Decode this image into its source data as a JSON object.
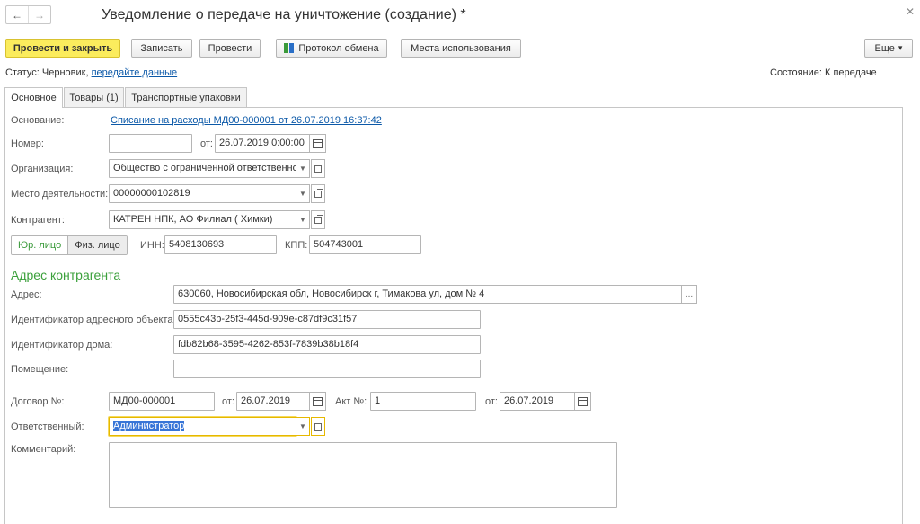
{
  "header": {
    "title": "Уведомление о передаче на уничтожение (создание) *",
    "back_icon": "arrow-left-icon",
    "forward_icon": "arrow-right-icon",
    "close_icon": "close-icon"
  },
  "toolbar": {
    "post_close": "Провести и закрыть",
    "save": "Записать",
    "post": "Провести",
    "exchange_protocol": "Протокол обмена",
    "usage_places": "Места использования",
    "more": "Еще",
    "more_arrow": "▾"
  },
  "status": {
    "label": "Статус:",
    "value": "Черновик,",
    "link": "передайте данные",
    "state": "Состояние: К передаче"
  },
  "tabs": [
    {
      "label": "Основное"
    },
    {
      "label": "Товары (1)"
    },
    {
      "label": "Транспортные упаковки"
    }
  ],
  "form": {
    "basis_label": "Основание:",
    "basis_link": "Списание на расходы МД00-000001 от 26.07.2019 16:37:42",
    "number_label": "Номер:",
    "number_value": "",
    "from_label": "от:",
    "date_value": "26.07.2019  0:00:00",
    "org_label": "Организация:",
    "org_value": "Общество с ограниченной ответственно",
    "place_label": "Место деятельности:",
    "place_value": "00000000102819",
    "contractor_label": "Контрагент:",
    "contractor_value": "КАТРЕН НПК, АО Филиал ( Химки)",
    "legal_entity": "Юр. лицо",
    "individual": "Физ. лицо",
    "inn_label": "ИНН:",
    "inn_value": "5408130693",
    "kpp_label": "КПП:",
    "kpp_value": "504743001",
    "address_section": "Адрес контрагента",
    "address_label": "Адрес:",
    "address_value": "630060, Новосибирская обл, Новосибирск г, Тимакова ул, дом № 4",
    "address_btn": "...",
    "addr_obj_label": "Идентификатор адресного объекта:",
    "addr_obj_value": "0555c43b-25f3-445d-909e-c87df9c31f57",
    "house_label": "Идентификатор дома:",
    "house_value": "fdb82b68-3595-4262-853f-7839b38b18f4",
    "room_label": "Помещение:",
    "room_value": "",
    "contract_label": "Договор №:",
    "contract_value": "МД00-000001",
    "contract_from_label": "от:",
    "contract_date": "26.07.2019",
    "act_label": "Акт №:",
    "act_value": "1",
    "act_from_label": "от:",
    "act_date": "26.07.2019",
    "responsible_label": "Ответственный:",
    "responsible_value": "Администратор",
    "comment_label": "Комментарий:",
    "comment_value": ""
  }
}
